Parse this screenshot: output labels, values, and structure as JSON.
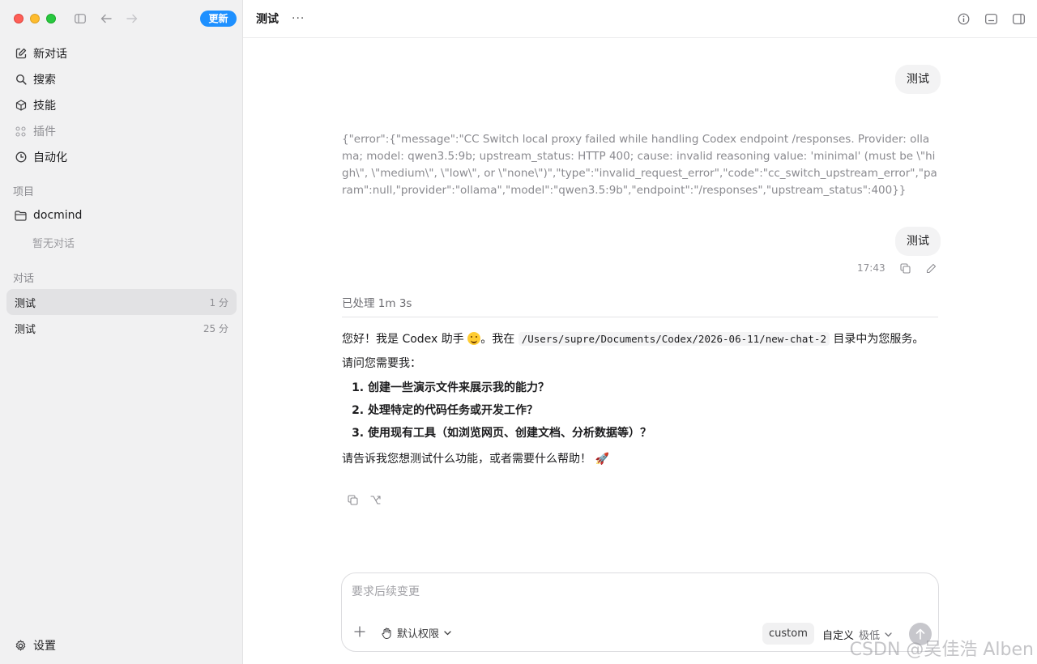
{
  "sidebar": {
    "update_label": "更新",
    "nav": [
      {
        "label": "新对话",
        "icon": "edit-icon"
      },
      {
        "label": "搜索",
        "icon": "search-icon"
      },
      {
        "label": "技能",
        "icon": "cube-icon"
      },
      {
        "label": "插件",
        "icon": "grid-icon"
      },
      {
        "label": "自动化",
        "icon": "clock-icon"
      }
    ],
    "projects_label": "项目",
    "project_name": "docmind",
    "no_conversations": "暂无对话",
    "conversations_label": "对话",
    "conversations": [
      {
        "title": "测试",
        "age": "1 分"
      },
      {
        "title": "测试",
        "age": "25 分"
      }
    ],
    "settings_label": "设置"
  },
  "header": {
    "title": "测试",
    "more": "···"
  },
  "chat": {
    "user_msg_1": "测试",
    "error_text": "{\"error\":{\"message\":\"CC Switch local proxy failed while handling Codex endpoint /responses. Provider: ollama; model: qwen3.5:9b; upstream_status: HTTP 400; cause: invalid reasoning value: 'minimal' (must be \\\"high\\\", \\\"medium\\\", \\\"low\\\", or \\\"none\\\")\",\"type\":\"invalid_request_error\",\"code\":\"cc_switch_upstream_error\",\"param\":null,\"provider\":\"ollama\",\"model\":\"qwen3.5:9b\",\"endpoint\":\"/responses\",\"upstream_status\":400}}",
    "user_msg_2": "测试",
    "time": "17:43",
    "processed": "已处理 1m 3s",
    "answer": {
      "intro_a": "您好！我是 Codex 助手 ",
      "intro_b": "。我在 ",
      "path": "/Users/supre/Documents/Codex/2026-06-11/new-chat-2",
      "intro_c": " 目录中为您服务。",
      "question": "请问您需要我：",
      "options": [
        "创建一些演示文件来展示我的能力？",
        "处理特定的代码任务或开发工作？",
        "使用现有工具（如浏览网页、创建文档、分析数据等）？"
      ],
      "closing": "请告诉我您想测试什么功能，或者需要什么帮助！ 🚀"
    }
  },
  "composer": {
    "placeholder": "要求后续变更",
    "permission": "默认权限",
    "model": "custom",
    "mode": "自定义",
    "level": "极低"
  },
  "watermark": "CSDN @吴佳浩 Alben",
  "colors": {
    "accent": "#1e90ff",
    "sidebar_bg": "#f1f1f2",
    "bubble_bg": "#f3f3f4"
  }
}
